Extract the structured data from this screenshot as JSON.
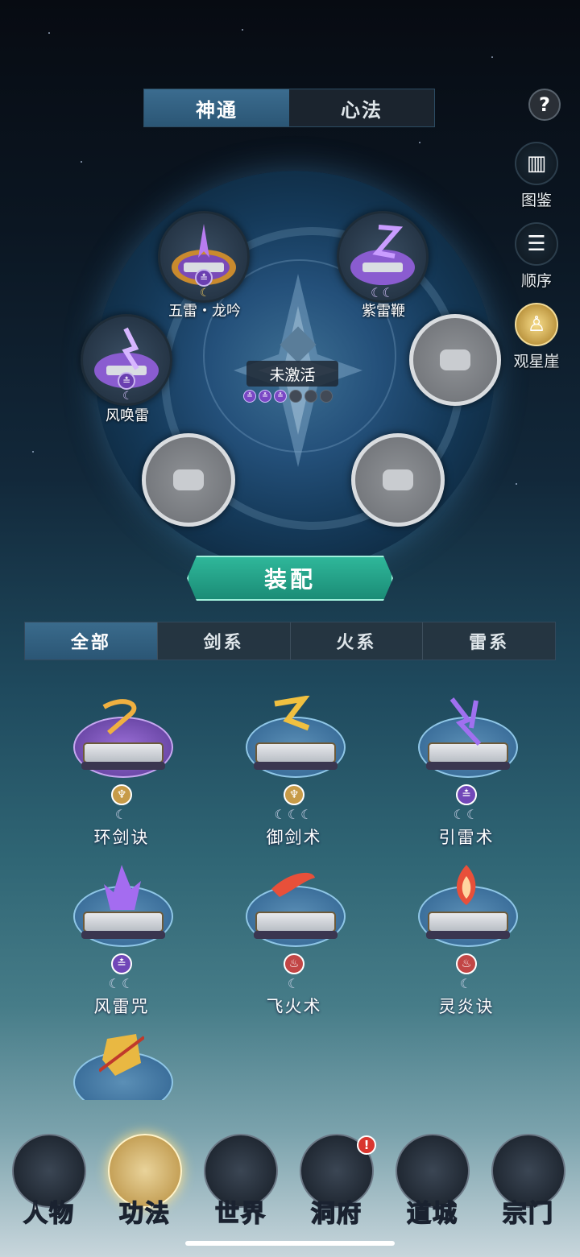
{
  "top_tabs": [
    {
      "label": "神通",
      "active": true
    },
    {
      "label": "心法",
      "active": false
    }
  ],
  "help_label": "?",
  "side_buttons": [
    {
      "label": "图鉴",
      "icon": "codex-icon"
    },
    {
      "label": "顺序",
      "icon": "order-icon"
    },
    {
      "label": "观星崖",
      "icon": "star-cliff-icon"
    }
  ],
  "center": {
    "label": "未激活",
    "dots": [
      "on",
      "on",
      "on",
      "off",
      "off",
      "off"
    ],
    "dot_glyph": "≛"
  },
  "slots": [
    {
      "name": "五雷・龙吟",
      "element": "thunder",
      "moons": 1
    },
    {
      "name": "紫雷鞭",
      "element": "thunder",
      "moons": 2
    },
    {
      "name": "风唤雷",
      "element": "thunder",
      "moons": 1
    }
  ],
  "equip_label": "装配",
  "filter_tabs": [
    {
      "label": "全部",
      "active": true
    },
    {
      "label": "剑系"
    },
    {
      "label": "火系"
    },
    {
      "label": "雷系"
    }
  ],
  "skills": [
    {
      "name": "环剑诀",
      "element": "sword",
      "moons": 1,
      "badge": "♆",
      "selected": true
    },
    {
      "name": "御剑术",
      "element": "sword",
      "moons": 3,
      "badge": "♆"
    },
    {
      "name": "引雷术",
      "element": "thunder",
      "moons": 2,
      "badge": "≛"
    },
    {
      "name": "风雷咒",
      "element": "thunder",
      "moons": 2,
      "badge": "≛"
    },
    {
      "name": "飞火术",
      "element": "fire",
      "moons": 1,
      "badge": "♨"
    },
    {
      "name": "灵炎诀",
      "element": "fire",
      "moons": 1,
      "badge": "♨"
    }
  ],
  "nav": [
    {
      "label": "人物",
      "icon": "character-icon"
    },
    {
      "label": "功法",
      "icon": "technique-icon",
      "active": true
    },
    {
      "label": "世界",
      "icon": "world-icon"
    },
    {
      "label": "洞府",
      "icon": "cave-icon",
      "notification": "!"
    },
    {
      "label": "道城",
      "icon": "city-icon"
    },
    {
      "label": "宗门",
      "icon": "sect-icon"
    }
  ],
  "colors": {
    "thunder": "#7147b8",
    "sword": "#c79b48",
    "fire": "#c24646",
    "accent": "#2fb79a"
  }
}
